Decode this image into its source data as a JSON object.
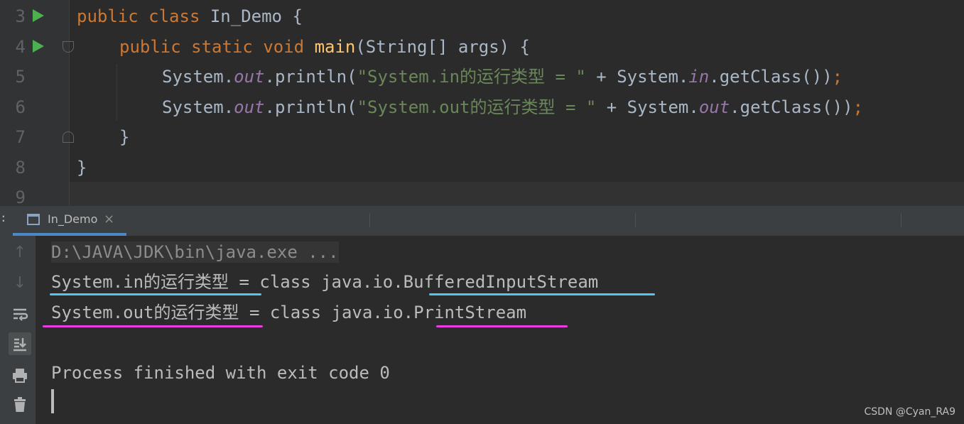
{
  "editor": {
    "line_numbers": [
      "3",
      "4",
      "5",
      "6",
      "7",
      "8",
      "9"
    ],
    "line3": {
      "kw_public": "public",
      "kw_class": "class",
      "rest": " In_Demo {"
    },
    "line4": {
      "kw_public": "public",
      "kw_static": "static",
      "kw_void": "void",
      "method": "main",
      "params": "(String[] args) {"
    },
    "line5": {
      "pre": "System.",
      "field": "out",
      "call": ".println(",
      "string": "\"System.in的运行类型 = \"",
      "mid": " + System.",
      "field2": "in",
      "tail": ".getClass())",
      "semi": ";"
    },
    "line6": {
      "pre": "System.",
      "field": "out",
      "call": ".println(",
      "string": "\"System.out的运行类型 = \"",
      "mid": " + System.",
      "field2": "out",
      "tail": ".getClass())",
      "semi": ";"
    },
    "line7": "}",
    "line8": "}"
  },
  "run_panel": {
    "tab_label": "In_Demo",
    "console": {
      "command": "D:\\JAVA\\JDK\\bin\\java.exe ...",
      "output_line1": "System.in的运行类型 = class java.io.BufferedInputStream",
      "output_line2": "System.out的运行类型 = class java.io.PrintStream",
      "exit_message": "Process finished with exit code 0"
    },
    "toolbar_icons": [
      "up-arrow-icon",
      "down-arrow-icon",
      "soft-wrap-icon",
      "scroll-to-end-icon",
      "print-icon",
      "trash-icon"
    ]
  },
  "watermark": "CSDN @Cyan_RA9",
  "colors": {
    "keyword": "#cc7832",
    "method": "#ffc66d",
    "string": "#6a8759",
    "static_field": "#9876aa",
    "annotation_blue": "#52c6f1",
    "annotation_pink": "#e83ee0"
  }
}
